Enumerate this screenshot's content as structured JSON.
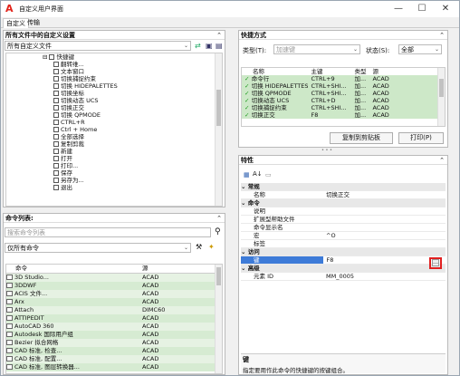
{
  "window": {
    "title": "自定义用户界面",
    "tabs": [
      "自定义",
      "传输"
    ],
    "controls": {
      "minimize": "—",
      "maximize": "☐",
      "close": "✕"
    }
  },
  "customizations": {
    "header": "所有文件中的自定义设置",
    "file_select": "所有自定义文件",
    "tree": [
      {
        "level": 2,
        "label": "快捷键",
        "expand": "⊟"
      },
      {
        "level": 3,
        "label": "翻转维..."
      },
      {
        "level": 3,
        "label": "文本窗口"
      },
      {
        "level": 3,
        "label": "切换捕捉约束"
      },
      {
        "level": 3,
        "label": "切换 HIDEPALETTES"
      },
      {
        "level": 3,
        "label": "切换坐标"
      },
      {
        "level": 3,
        "label": "切换动态 UCS"
      },
      {
        "level": 3,
        "label": "切换正交"
      },
      {
        "level": 3,
        "label": "切换 QPMODE"
      },
      {
        "level": 3,
        "label": "CTRL+R"
      },
      {
        "level": 3,
        "label": "Ctrl + Home"
      },
      {
        "level": 3,
        "label": "全部选择"
      },
      {
        "level": 3,
        "label": "复制剪裁"
      },
      {
        "level": 3,
        "label": "新建"
      },
      {
        "level": 3,
        "label": "打开"
      },
      {
        "level": 3,
        "label": "打印..."
      },
      {
        "level": 3,
        "label": "保存"
      },
      {
        "level": 3,
        "label": "另存为..."
      },
      {
        "level": 3,
        "label": "退出"
      }
    ]
  },
  "commands": {
    "header": "命令列表:",
    "search_placeholder": "搜索命令列表",
    "filter_select": "仅所有命令",
    "columns": [
      "命令",
      "源"
    ],
    "rows": [
      {
        "name": "3D Studio...",
        "src": "ACAD"
      },
      {
        "name": "3DDWF",
        "src": "ACAD"
      },
      {
        "name": "ACIS 文件...",
        "src": "ACAD"
      },
      {
        "name": "Arx",
        "src": "ACAD"
      },
      {
        "name": "Attach",
        "src": "DIMC60"
      },
      {
        "name": "ATTIPEDIT",
        "src": "ACAD"
      },
      {
        "name": "AutoCAD 360",
        "src": "ACAD"
      },
      {
        "name": "Autodesk 国际用户组",
        "src": "ACAD"
      },
      {
        "name": "Bezier 拟合网格",
        "src": "ACAD"
      },
      {
        "name": "CAD 标准, 检查...",
        "src": "ACAD"
      },
      {
        "name": "CAD 标准, 配置...",
        "src": "ACAD"
      },
      {
        "name": "CAD 标准, 图层转换器...",
        "src": "ACAD"
      }
    ]
  },
  "shortcuts": {
    "header": "快捷方式",
    "type_label": "类型(T):",
    "type_value": "加速键",
    "status_label": "状态(S):",
    "status_value": "全部",
    "columns": [
      "名称",
      "主键",
      "类型",
      "源"
    ],
    "rows": [
      {
        "name": "命令行",
        "key": "CTRL+9",
        "type": "加...",
        "src": "ACAD"
      },
      {
        "name": "切换 HIDEPALETTES",
        "key": "CTRL+SHI...",
        "type": "加...",
        "src": "ACAD"
      },
      {
        "name": "切换 QPMODE",
        "key": "CTRL+SHI...",
        "type": "加...",
        "src": "ACAD"
      },
      {
        "name": "切换动态 UCS",
        "key": "CTRL+D",
        "type": "加...",
        "src": "ACAD"
      },
      {
        "name": "切换捕捉约束",
        "key": "CTRL+SHI...",
        "type": "加...",
        "src": "ACAD"
      },
      {
        "name": "切换正交",
        "key": "F8",
        "type": "加...",
        "src": "ACAD"
      }
    ],
    "copy_button": "复制到剪贴板",
    "print_button": "打印(P)"
  },
  "properties": {
    "header": "特性",
    "sort_icon": "A↓",
    "sections": [
      {
        "cat": "常规",
        "rows": [
          {
            "k": "名称",
            "v": "切换正交"
          }
        ]
      },
      {
        "cat": "命令",
        "rows": [
          {
            "k": "说明",
            "v": ""
          },
          {
            "k": "扩展型帮助文件",
            "v": ""
          },
          {
            "k": "命令显示名",
            "v": ""
          },
          {
            "k": "宏",
            "v": "^O"
          },
          {
            "k": "标签",
            "v": ""
          }
        ]
      },
      {
        "cat": "访问",
        "rows": [
          {
            "k": "键",
            "v": "F8"
          }
        ]
      },
      {
        "cat": "高级",
        "rows": [
          {
            "k": "元素 ID",
            "v": "MM_0005"
          }
        ]
      }
    ],
    "desc_title": "键",
    "desc_text": "指定要用作此命令的快捷键的按键组合。",
    "ellipsis": "…"
  },
  "colors": {
    "accent": "#3d7bd8",
    "green": "#1e9b1e",
    "highlight_box": "#e02020"
  }
}
